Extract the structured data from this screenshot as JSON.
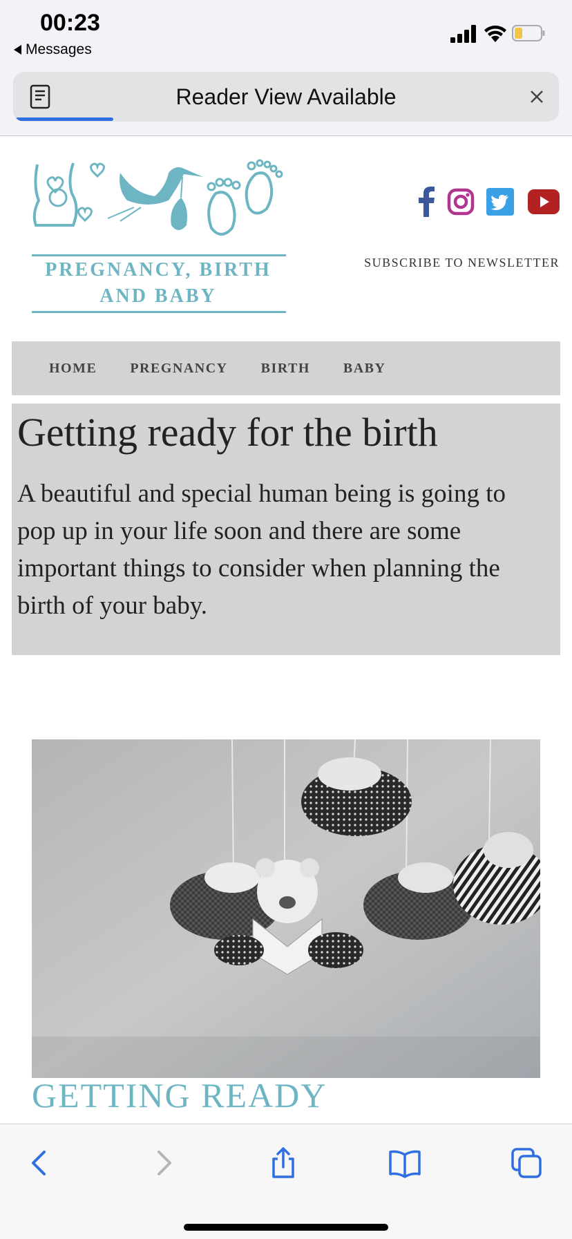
{
  "status_bar": {
    "time": "00:23",
    "back_app": "Messages"
  },
  "reader_bar": {
    "label": "Reader View Available",
    "progress": 0.18
  },
  "site": {
    "logo_line1": "PREGNANCY, BIRTH",
    "logo_line2": "AND BABY",
    "newsletter": "SUBSCRIBE TO NEWSLETTER",
    "social": [
      "facebook-icon",
      "instagram-icon",
      "twitter-icon",
      "youtube-icon"
    ],
    "colors": {
      "brand": "#6eb5c4",
      "facebook": "#3b5998",
      "instagram": "#b1348f",
      "twitter": "#3ba1e6",
      "youtube": "#b22222"
    }
  },
  "nav": {
    "items": [
      "HOME",
      "PREGNANCY",
      "BIRTH",
      "BABY"
    ]
  },
  "hero": {
    "title": "Getting ready for the birth",
    "body": "A beautiful and special human being is going to pop up in your life soon and there are some important things to consider when planning the birth of your baby."
  },
  "section": {
    "heading": "GETTING READY"
  },
  "toolbar": {
    "icons": [
      "back-icon",
      "forward-icon",
      "share-icon",
      "bookmarks-icon",
      "tabs-icon"
    ],
    "accent": "#2f6fe0"
  }
}
